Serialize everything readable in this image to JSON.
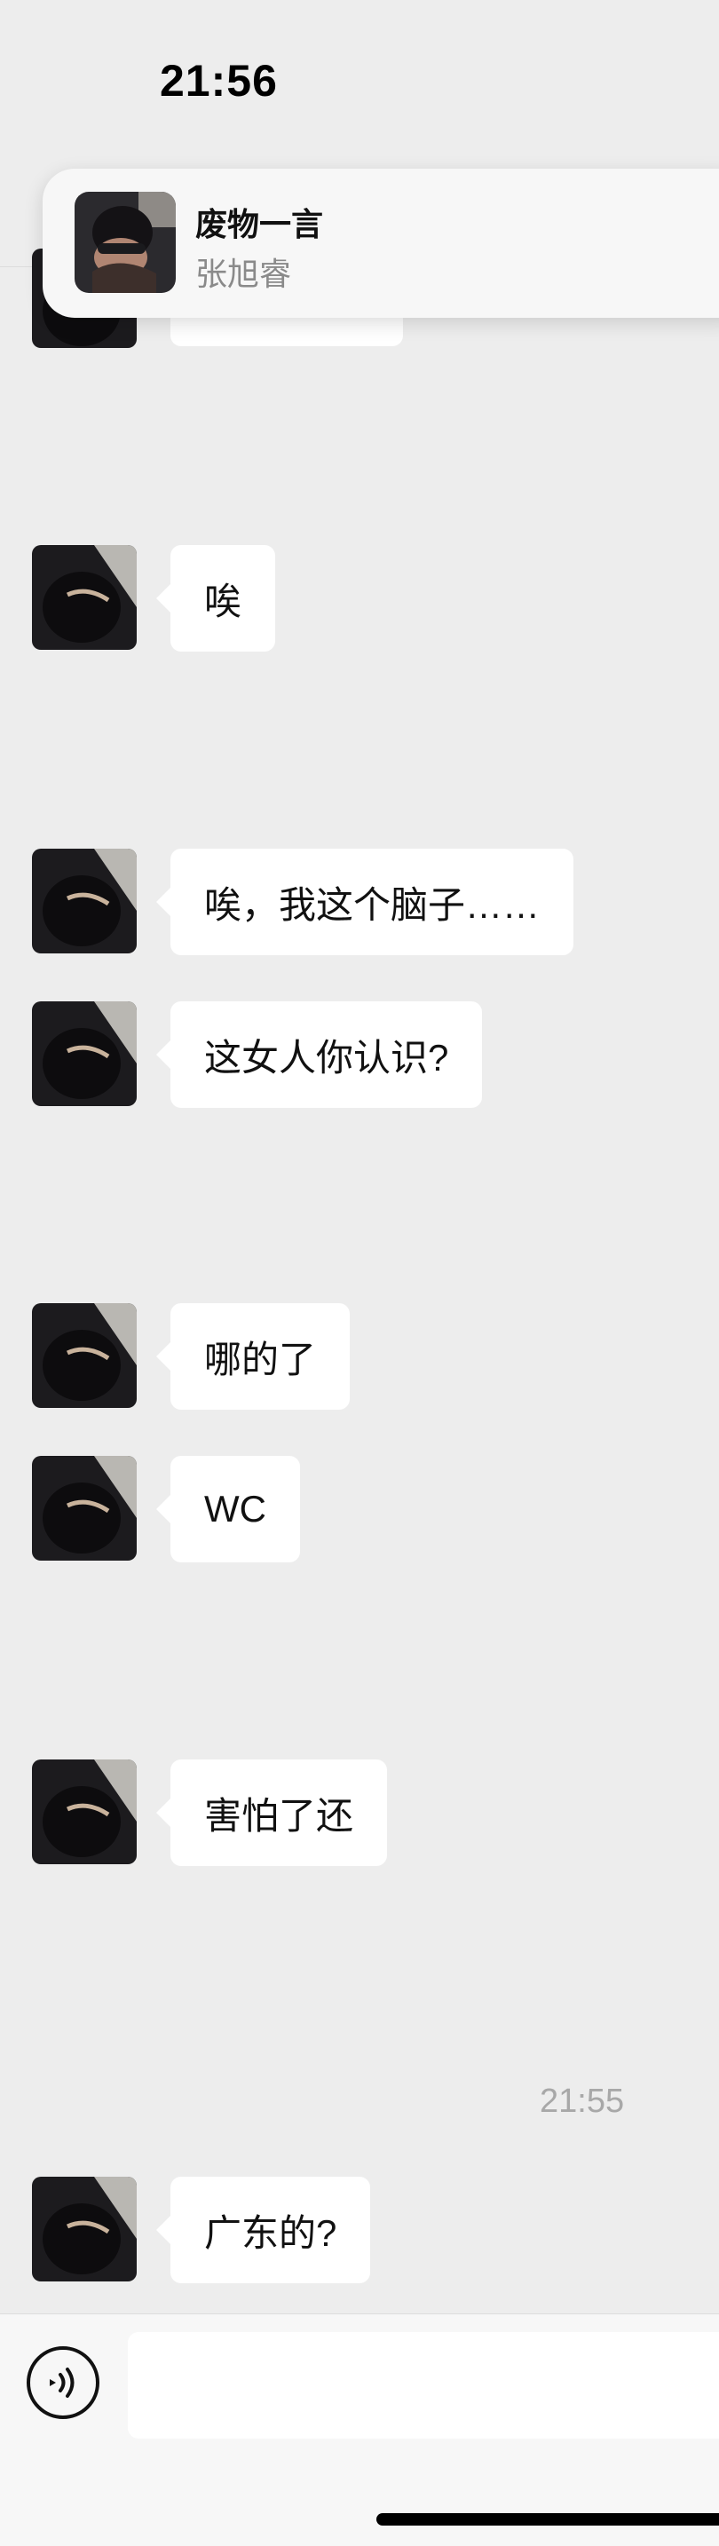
{
  "status_bar": {
    "time": "21:56"
  },
  "notification": {
    "title": "废物一言",
    "subtitle": "张旭睿"
  },
  "messages": [
    {
      "text": "唉"
    },
    {
      "text": "唉，我这个脑子……"
    },
    {
      "text": "这女人你认识?"
    },
    {
      "text": "哪的了"
    },
    {
      "text": "WC"
    },
    {
      "text": "害怕了还"
    },
    {
      "text": "广东的?"
    }
  ],
  "timestamp": "21:55",
  "input_bar": {
    "placeholder": "",
    "value": ""
  },
  "icons": {
    "voice": "voice-icon",
    "avatar": "avatar-photo"
  },
  "colors": {
    "background": "#ededed",
    "bubble": "#ffffff",
    "timestamp": "#a8a8a8"
  }
}
